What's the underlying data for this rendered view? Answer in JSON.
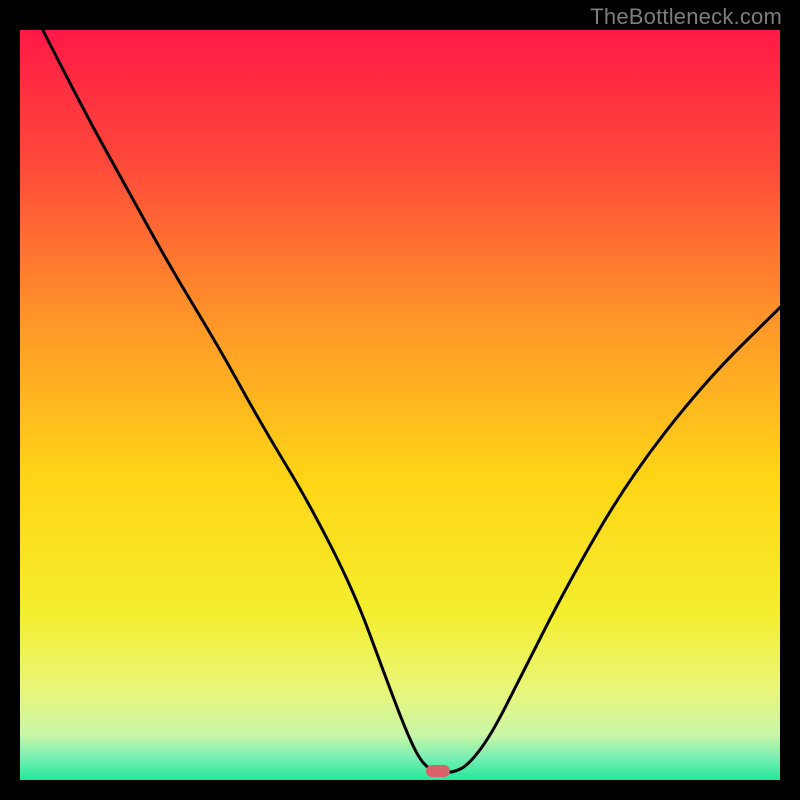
{
  "watermark": "TheBottleneck.com",
  "chart_data": {
    "type": "line",
    "title": "",
    "xlabel": "",
    "ylabel": "",
    "xlim": [
      0,
      100
    ],
    "ylim": [
      0,
      100
    ],
    "grid": false,
    "legend": false,
    "background_gradient": {
      "stops": [
        {
          "offset": 0.0,
          "color": "#ff1946"
        },
        {
          "offset": 0.18,
          "color": "#ff4a3a"
        },
        {
          "offset": 0.4,
          "color": "#ff9a28"
        },
        {
          "offset": 0.6,
          "color": "#ffd616"
        },
        {
          "offset": 0.78,
          "color": "#f4ee2e"
        },
        {
          "offset": 0.88,
          "color": "#e9f67a"
        },
        {
          "offset": 0.94,
          "color": "#c9f6a6"
        },
        {
          "offset": 0.97,
          "color": "#79efb4"
        },
        {
          "offset": 1.0,
          "color": "#23e79a"
        }
      ]
    },
    "marker": {
      "x": 55,
      "y": 1.2,
      "color": "#d9636b"
    },
    "series": [
      {
        "name": "curve",
        "color": "#000000",
        "x": [
          3,
          8,
          14,
          20,
          26,
          32,
          38,
          44,
          48,
          51,
          53,
          55,
          57,
          59,
          62,
          66,
          72,
          80,
          90,
          100
        ],
        "y": [
          100,
          90,
          79,
          68,
          58,
          47,
          37,
          25,
          14,
          6,
          2,
          1,
          1,
          2,
          6,
          14,
          26,
          40,
          53,
          63
        ]
      }
    ]
  }
}
